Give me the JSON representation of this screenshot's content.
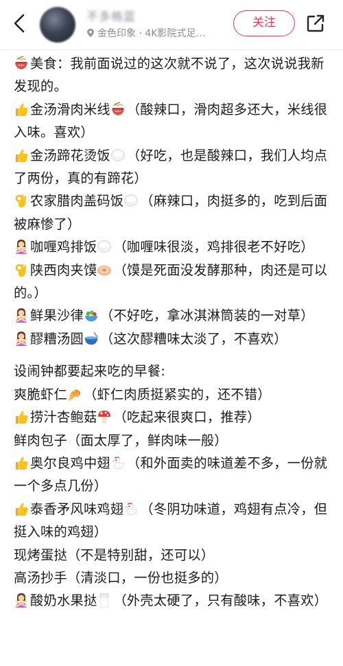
{
  "header": {
    "author_name": "不多格蓝",
    "location": "金色印象 · 4K影院式足…",
    "follow_label": "关注"
  },
  "paragraphs": [
    {
      "emoji": "noodle-bowl-icon",
      "text": "美食：我前面说过的这次就不说了，这次说说我新发现的。"
    },
    {
      "emoji": "thumbs-up-icon",
      "text": "金汤滑肉米线",
      "emoji2": "noodle-bowl-icon",
      "text2": "（酸辣口，滑肉超多还大，米线很入味。喜欢）"
    },
    {
      "emoji": "thumbs-up-icon",
      "text": "金汤蹄花烫饭",
      "emoji2": "rice-bowl-icon",
      "text2": "（好吃，也是酸辣口，我们人均点了两份，真的有蹄花）"
    },
    {
      "emoji": "ok-hand-icon",
      "text": "农家腊肉盖码饭",
      "emoji2": "rice-bowl-icon",
      "text2": "（麻辣口，肉挺多的，吃到后面被麻惨了）"
    },
    {
      "emoji": "person-gesturing-no-icon",
      "text": "咖喱鸡排饭",
      "emoji2": "rice-bowl-icon",
      "text2": "（咖喱味很淡，鸡排很老不好吃）"
    },
    {
      "emoji": "ok-hand-icon",
      "text": "陕西肉夹馍",
      "emoji2": "bagel-icon",
      "text2": "（馍是死面没发酵那种，肉还是可以的。）"
    },
    {
      "emoji": "person-gesturing-no-icon",
      "text": "鲜果沙律",
      "emoji2": "salad-icon",
      "text2": "（不好吃，拿冰淇淋筒装的一对草）"
    },
    {
      "emoji": "person-gesturing-no-icon",
      "text": "醪糟汤圆",
      "emoji2": "soup-bowl-icon",
      "text2": "（这次醪糟味太淡了，不喜欢）"
    },
    {
      "gap": true
    },
    {
      "text": "设闹钟都要起来吃的早餐:"
    },
    {
      "text": "爽脆虾仁",
      "emoji2": "shrimp-icon",
      "text2": "（虾仁肉质挺紧实的，还不错）"
    },
    {
      "emoji": "thumbs-up-icon",
      "text": "捞汁杏鲍菇",
      "emoji2": "mushroom-icon",
      "text2": "（吃起来很爽口，推荐）"
    },
    {
      "text": "鲜肉包子（面太厚了，鲜肉味一般）"
    },
    {
      "emoji": "thumbs-up-icon",
      "text": "奥尔良鸡中翅",
      "emoji2": "chicken-icon",
      "text2": "（和外面卖的味道差不多，一份就一个多点几份）"
    },
    {
      "emoji": "thumbs-up-icon",
      "text": "泰香矛风味鸡翅",
      "emoji2": "chicken-icon",
      "text2": "（冬阴功味道，鸡翅有点冷，但挺入味的鸡翅）"
    },
    {
      "text": "现烤蛋挞（不是特别甜，还可以）"
    },
    {
      "text": "高汤抄手（清淡口，一份也挺多的）"
    },
    {
      "emoji": "person-gesturing-no-icon",
      "text": "酸奶水果挞",
      "emoji2": "milk-glass-icon",
      "text2": "（外壳太硬了，只有酸味，不喜欢）"
    }
  ],
  "colors": {
    "accent": "#ff2e4d",
    "text": "#1b1b1b",
    "muted": "#8c8c8c"
  }
}
